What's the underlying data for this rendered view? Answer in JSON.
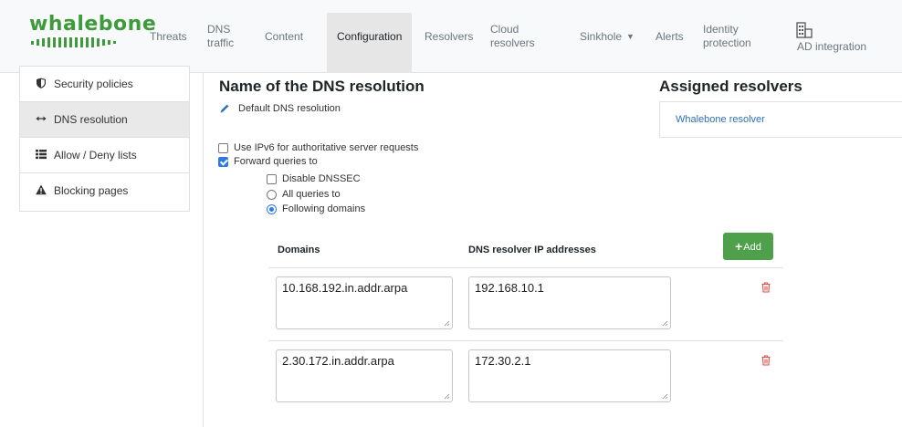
{
  "brand": {
    "name": "whalebone",
    "color": "#3f9a3c"
  },
  "nav": {
    "items": [
      {
        "label": "Threats",
        "label2": ""
      },
      {
        "label": "DNS",
        "label2": "traffic"
      },
      {
        "label": "Content",
        "label2": ""
      },
      {
        "label": "Configuration",
        "label2": "",
        "active": true
      },
      {
        "label": "Resolvers",
        "label2": ""
      },
      {
        "label": "Cloud",
        "label2": "resolvers"
      },
      {
        "label": "Sinkhole",
        "label2": "",
        "dropdown": true
      },
      {
        "label": "Alerts",
        "label2": ""
      },
      {
        "label": "Identity",
        "label2": "protection"
      },
      {
        "label": "AD integration",
        "label2": "",
        "icon": "building-icon"
      }
    ]
  },
  "sidebar": {
    "items": [
      {
        "label": "Security policies",
        "icon": "shield-icon"
      },
      {
        "label": "DNS resolution",
        "icon": "arrows-horizontal-icon",
        "active": true
      },
      {
        "label": "Allow / Deny lists",
        "icon": "list-icon"
      },
      {
        "label": "Blocking pages",
        "icon": "warning-icon"
      }
    ]
  },
  "main": {
    "title": "Name of the DNS resolution",
    "name_value": "Default DNS resolution",
    "options": {
      "ipv6": {
        "label": "Use IPv6 for authoritative server requests",
        "checked": false
      },
      "forward": {
        "label": "Forward queries to",
        "checked": true
      },
      "dnssec": {
        "label": "Disable DNSSEC",
        "checked": false
      },
      "all_queries": {
        "label": "All queries to",
        "selected": false
      },
      "following": {
        "label": "Following domains",
        "selected": true
      }
    },
    "table": {
      "col_domains": "Domains",
      "col_resolvers": "DNS resolver IP addresses",
      "add_icon": "+",
      "add_label": "Add",
      "rows": [
        {
          "domain": "10.168.192.in.addr.arpa",
          "ip": "192.168.10.1"
        },
        {
          "domain": "2.30.172.in.addr.arpa",
          "ip": "172.30.2.1"
        }
      ]
    }
  },
  "assigned": {
    "title": "Assigned resolvers",
    "resolver": "Whalebone resolver"
  },
  "colors": {
    "accent_green": "#4ea14a",
    "link_blue": "#2f6fb5",
    "danger_red": "#d9534f",
    "check_blue": "#2f7be0"
  }
}
